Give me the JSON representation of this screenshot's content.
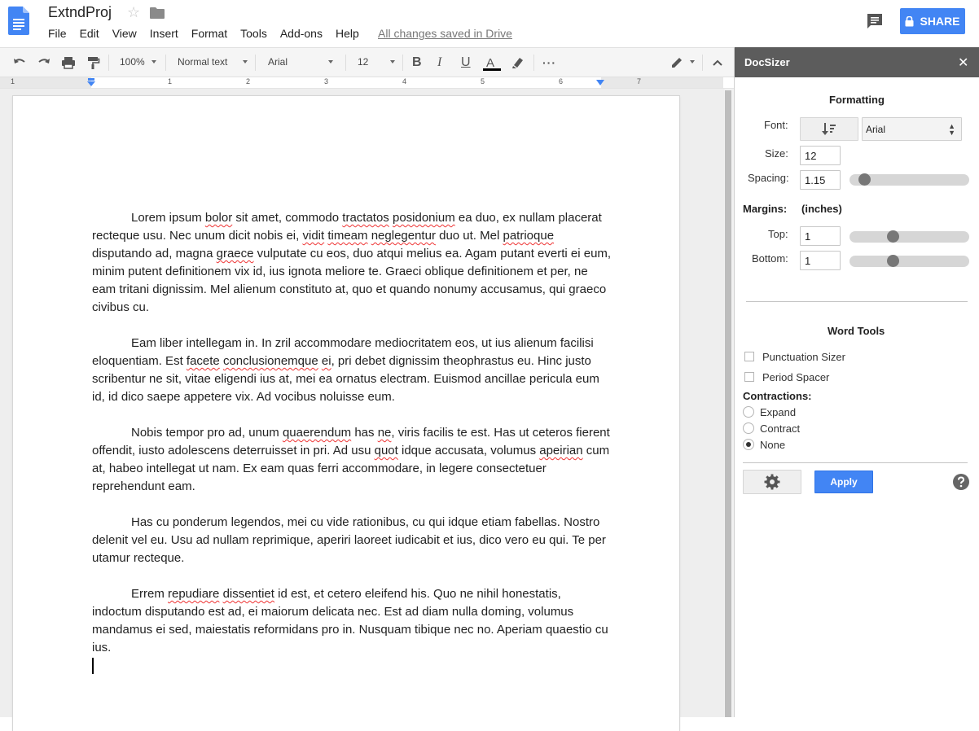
{
  "header": {
    "doc_title": "ExtndProj",
    "menu": [
      "File",
      "Edit",
      "View",
      "Insert",
      "Format",
      "Tools",
      "Add-ons",
      "Help"
    ],
    "saved_status": "All changes saved in Drive",
    "share_label": "SHARE"
  },
  "toolbar": {
    "zoom": "100%",
    "style": "Normal text",
    "font": "Arial",
    "font_size": "12",
    "bold_label": "B",
    "italic_label": "I",
    "underline_label": "U",
    "text_color_label": "A",
    "more_label": "···"
  },
  "ruler": {
    "numbers": [
      "1",
      "1",
      "2",
      "3",
      "4",
      "5",
      "6",
      "7"
    ]
  },
  "document": {
    "paragraphs": [
      {
        "segments": [
          {
            "text": "Lorem ipsum "
          },
          {
            "text": "bolor",
            "spell": true
          },
          {
            "text": " sit amet, commodo "
          },
          {
            "text": "tractatos",
            "spell": true
          },
          {
            "text": " "
          },
          {
            "text": "posidonium",
            "spell": true
          },
          {
            "text": " ea duo, ex nullam placerat recteque usu. Nec unum dicit nobis ei, "
          },
          {
            "text": "vidit",
            "spell": true
          },
          {
            "text": " "
          },
          {
            "text": "timeam",
            "spell": true
          },
          {
            "text": " "
          },
          {
            "text": "neglegentur",
            "spell": true
          },
          {
            "text": " duo ut. Mel "
          },
          {
            "text": "patrioque",
            "spell": true
          },
          {
            "text": " disputando ad, magna "
          },
          {
            "text": "graece",
            "spell": true
          },
          {
            "text": " vulputate cu eos, duo atqui melius ea. Agam putant everti ei eum, minim putent definitionem vix id, ius ignota meliore te. Graeci oblique definitionem et per, ne eam tritani dignissim. Mel alienum constituto at, quo et quando nonumy accusamus, qui graeco civibus cu."
          }
        ]
      },
      {
        "segments": [
          {
            "text": "Eam liber intellegam in. In zril accommodare mediocritatem eos, ut ius alienum facilisi eloquentiam. Est "
          },
          {
            "text": "facete",
            "spell": true
          },
          {
            "text": " "
          },
          {
            "text": "conclusionemque",
            "spell": true
          },
          {
            "text": " "
          },
          {
            "text": "ei",
            "spell": true
          },
          {
            "text": ", pri debet dignissim theophrastus eu. Hinc justo scribentur ne sit, vitae eligendi ius at, mei ea ornatus electram. Euismod ancillae pericula eum id, id dico saepe appetere vix. Ad vocibus noluisse eum."
          }
        ]
      },
      {
        "segments": [
          {
            "text": "Nobis tempor pro ad, unum "
          },
          {
            "text": "quaerendum",
            "spell": true
          },
          {
            "text": " has "
          },
          {
            "text": "ne",
            "spell": true
          },
          {
            "text": ", viris facilis te est. Has ut ceteros fierent offendit, iusto adolescens deterruisset in pri. Ad usu "
          },
          {
            "text": "quot",
            "spell": true
          },
          {
            "text": " idque accusata, volumus "
          },
          {
            "text": "apeirian",
            "spell": true
          },
          {
            "text": " cum at, habeo intellegat ut nam. Ex eam quas ferri accommodare, in legere consectetuer reprehendunt eam."
          }
        ]
      },
      {
        "segments": [
          {
            "text": "Has cu ponderum legendos, mei cu vide rationibus, cu qui idque etiam fabellas. Nostro delenit vel eu. Usu ad nullam reprimique, aperiri laoreet iudicabit et ius, dico vero eu qui. Te per utamur recteque."
          }
        ]
      },
      {
        "segments": [
          {
            "text": "Errem "
          },
          {
            "text": "repudiare",
            "spell": true
          },
          {
            "text": " "
          },
          {
            "text": "dissentiet",
            "spell": true
          },
          {
            "text": " id est, et cetero eleifend his. Quo ne nihil honestatis, indoctum disputando est ad, ei maiorum delicata nec. Est ad diam nulla doming, volumus mandamus ei sed, maiestatis reformidans pro in. Nusquam tibique nec no. Aperiam quaestio cu ius."
          }
        ]
      }
    ]
  },
  "sidebar": {
    "title": "DocSizer",
    "close_glyph": "✕",
    "formatting_heading": "Formatting",
    "font_label": "Font:",
    "font_value": "Arial",
    "size_label": "Size:",
    "size_value": "12",
    "spacing_label": "Spacing:",
    "spacing_value": "1.15",
    "spacing_slider_fraction": 0.08,
    "margins_label": "Margins:",
    "margins_unit": "(inches)",
    "top_label": "Top:",
    "top_value": "1",
    "top_slider_fraction": 0.35,
    "bottom_label": "Bottom:",
    "bottom_value": "1",
    "bottom_slider_fraction": 0.35,
    "word_tools_heading": "Word Tools",
    "punctuation_label": "Punctuation Sizer",
    "punctuation_checked": false,
    "period_label": "Period Spacer",
    "period_checked": false,
    "contractions_label": "Contractions:",
    "contraction_options": [
      "Expand",
      "Contract",
      "None"
    ],
    "contraction_selected": "None",
    "apply_label": "Apply"
  },
  "colors": {
    "accent": "#4285f4",
    "sidebar_header": "#5c5c5c",
    "spell_underline": "#e33333"
  }
}
